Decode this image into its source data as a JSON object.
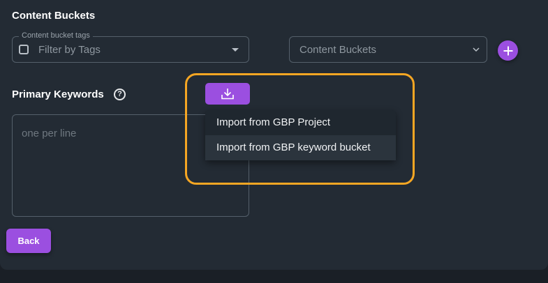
{
  "content_buckets": {
    "title": "Content Buckets",
    "tags_field": {
      "legend": "Content bucket tags",
      "placeholder": "Filter by Tags"
    },
    "bucket_select": {
      "placeholder": "Content Buckets"
    }
  },
  "primary_keywords": {
    "title": "Primary Keywords",
    "help_icon": "?",
    "textarea_placeholder": "one per line"
  },
  "import_menu": {
    "items": [
      {
        "label": "Import from GBP Project"
      },
      {
        "label": "Import from GBP keyword bucket"
      }
    ]
  },
  "footer": {
    "back_label": "Back"
  },
  "colors": {
    "accent": "#9b4fe0",
    "highlight": "#f5a623",
    "panel": "#232b34",
    "page": "#1a1f26"
  },
  "icons": {
    "add": "plus-icon",
    "download": "download-icon",
    "help": "help-icon",
    "dropdown": "chevron-down-icon"
  }
}
